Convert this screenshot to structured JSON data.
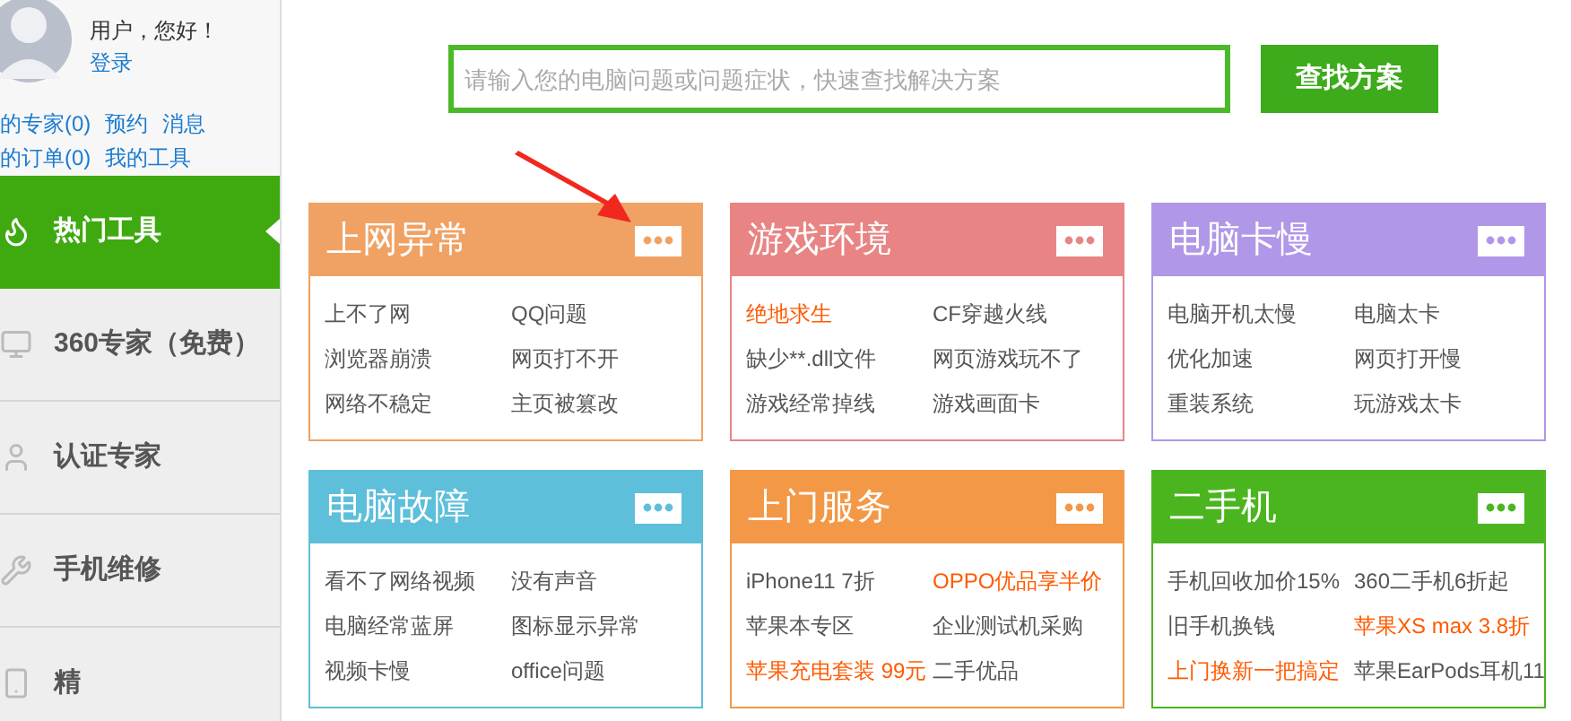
{
  "user": {
    "greeting": "用户，您好！",
    "login": "登录",
    "links": [
      [
        "的专家(0)",
        "预约",
        "消息"
      ],
      [
        "的订单(0)",
        "我的工具"
      ]
    ]
  },
  "sidebar": {
    "items": [
      {
        "label": "热门工具",
        "selected": true
      },
      {
        "label": "360专家（免费）",
        "selected": false
      },
      {
        "label": "认证专家",
        "selected": false
      },
      {
        "label": "手机维修",
        "selected": false
      },
      {
        "label": "精",
        "selected": false
      }
    ]
  },
  "search": {
    "placeholder": "请输入您的电脑问题或问题症状，快速查找解决方案",
    "button": "查找方案"
  },
  "cards": [
    {
      "title": "上网异常",
      "color": "#f0a264",
      "rows": [
        [
          {
            "text": "上不了网",
            "highlight": false
          },
          {
            "text": "QQ问题",
            "highlight": false
          }
        ],
        [
          {
            "text": "浏览器崩溃",
            "highlight": false
          },
          {
            "text": "网页打不开",
            "highlight": false
          }
        ],
        [
          {
            "text": "网络不稳定",
            "highlight": false
          },
          {
            "text": "主页被篡改",
            "highlight": false
          }
        ]
      ]
    },
    {
      "title": "游戏环境",
      "color": "#e88584",
      "rows": [
        [
          {
            "text": "绝地求生",
            "highlight": true
          },
          {
            "text": "CF穿越火线",
            "highlight": false
          }
        ],
        [
          {
            "text": "缺少**.dll文件",
            "highlight": false
          },
          {
            "text": "网页游戏玩不了",
            "highlight": false
          }
        ],
        [
          {
            "text": "游戏经常掉线",
            "highlight": false
          },
          {
            "text": "游戏画面卡",
            "highlight": false
          }
        ]
      ]
    },
    {
      "title": "电脑卡慢",
      "color": "#b097e8",
      "rows": [
        [
          {
            "text": "电脑开机太慢",
            "highlight": false
          },
          {
            "text": "电脑太卡",
            "highlight": false
          }
        ],
        [
          {
            "text": "优化加速",
            "highlight": false
          },
          {
            "text": "网页打开慢",
            "highlight": false
          }
        ],
        [
          {
            "text": "重装系统",
            "highlight": false
          },
          {
            "text": "玩游戏太卡",
            "highlight": false
          }
        ]
      ]
    },
    {
      "title": "电脑故障",
      "color": "#5dbfd9",
      "rows": [
        [
          {
            "text": "看不了网络视频",
            "highlight": false
          },
          {
            "text": "没有声音",
            "highlight": false
          }
        ],
        [
          {
            "text": "电脑经常蓝屏",
            "highlight": false
          },
          {
            "text": "图标显示异常",
            "highlight": false
          }
        ],
        [
          {
            "text": "视频卡慢",
            "highlight": false
          },
          {
            "text": "office问题",
            "highlight": false
          }
        ]
      ]
    },
    {
      "title": "上门服务",
      "color": "#f39846",
      "rows": [
        [
          {
            "text": "iPhone11 7折",
            "highlight": false
          },
          {
            "text": "OPPO优品享半价",
            "highlight": true
          }
        ],
        [
          {
            "text": "苹果本专区",
            "highlight": false
          },
          {
            "text": "企业测试机采购",
            "highlight": false
          }
        ],
        [
          {
            "text": "苹果充电套装 99元",
            "highlight": true
          },
          {
            "text": "二手优品",
            "highlight": false
          }
        ]
      ]
    },
    {
      "title": "二手机",
      "color": "#4bb51f",
      "rows": [
        [
          {
            "text": "手机回收加价15%",
            "highlight": false
          },
          {
            "text": "360二手机6折起",
            "highlight": false
          }
        ],
        [
          {
            "text": "旧手机换钱",
            "highlight": false
          },
          {
            "text": "苹果XS max 3.8折",
            "highlight": true
          }
        ],
        [
          {
            "text": "上门换新一把搞定",
            "highlight": true
          },
          {
            "text": "苹果EarPods耳机11",
            "highlight": false
          }
        ]
      ]
    }
  ]
}
